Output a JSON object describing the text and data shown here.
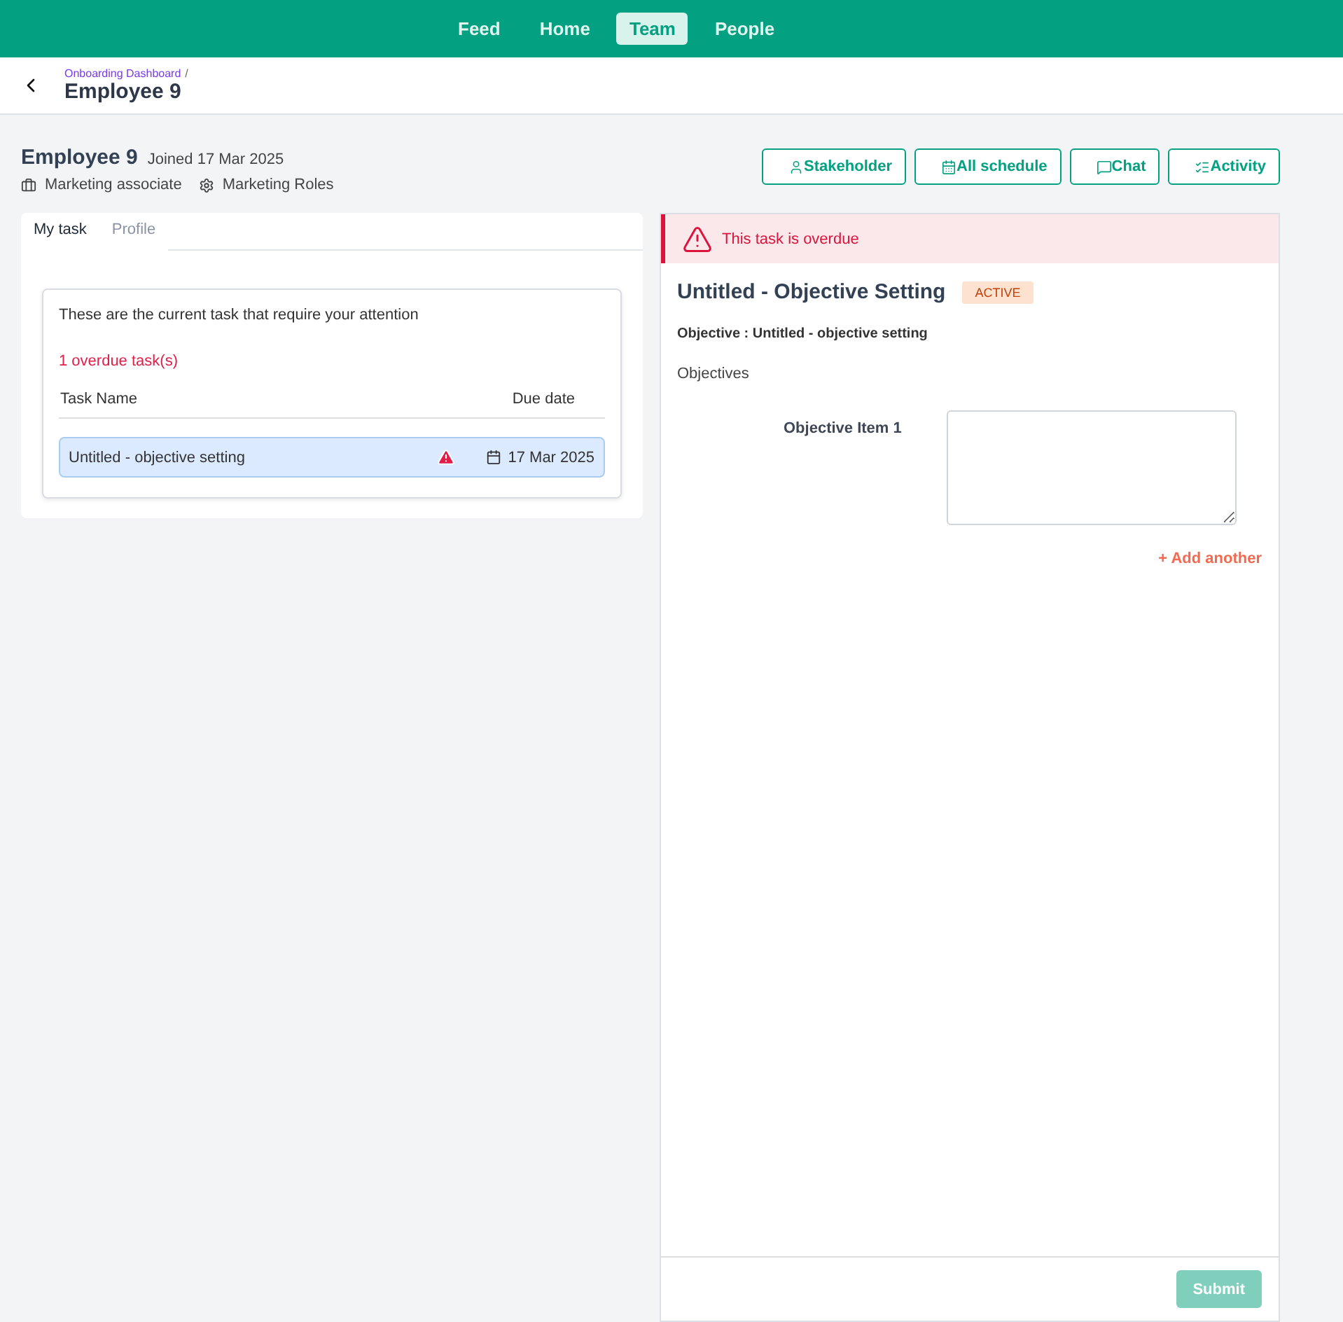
{
  "nav": [
    {
      "label": "Feed",
      "selected": false
    },
    {
      "label": "Home",
      "selected": false
    },
    {
      "label": "Team",
      "selected": true
    },
    {
      "label": "People",
      "selected": false
    }
  ],
  "header": {
    "breadcrumb": "Onboarding Dashboard",
    "separator": "/",
    "title": "Employee 9"
  },
  "employee": {
    "name": "Employee 9",
    "joined": "Joined 17 Mar 2025",
    "role": "Marketing associate",
    "group": "Marketing Roles"
  },
  "actions": [
    {
      "kind": "stakeholder",
      "label": "Stakeholder"
    },
    {
      "kind": "schedule",
      "label": "All schedule"
    },
    {
      "kind": "chat",
      "label": "Chat"
    },
    {
      "kind": "activity",
      "label": "Activity"
    }
  ],
  "tabs": [
    {
      "label": "My task",
      "selected": true
    },
    {
      "label": "Profile",
      "selected": false
    }
  ],
  "task_card": {
    "intro": "These are the current task that require your attention",
    "overdue_count": "1 overdue task(s)",
    "columns": [
      "Task Name",
      "Due date"
    ],
    "rows": [
      {
        "name": "Untitled - objective setting",
        "overdue": true,
        "selected": true,
        "due": "17 Mar 2025"
      }
    ]
  },
  "task_panel": {
    "alert": "This task is overdue",
    "title": "Untitled - Objective Setting",
    "status": "ACTIVE",
    "objective": "Objective : Untitled - objective setting",
    "section": "Objectives",
    "items": [
      {
        "label": "Objective Item 1",
        "value": ""
      }
    ],
    "add_link": "+ Add another",
    "submit": {
      "label": "Submit",
      "disabled": true
    }
  }
}
